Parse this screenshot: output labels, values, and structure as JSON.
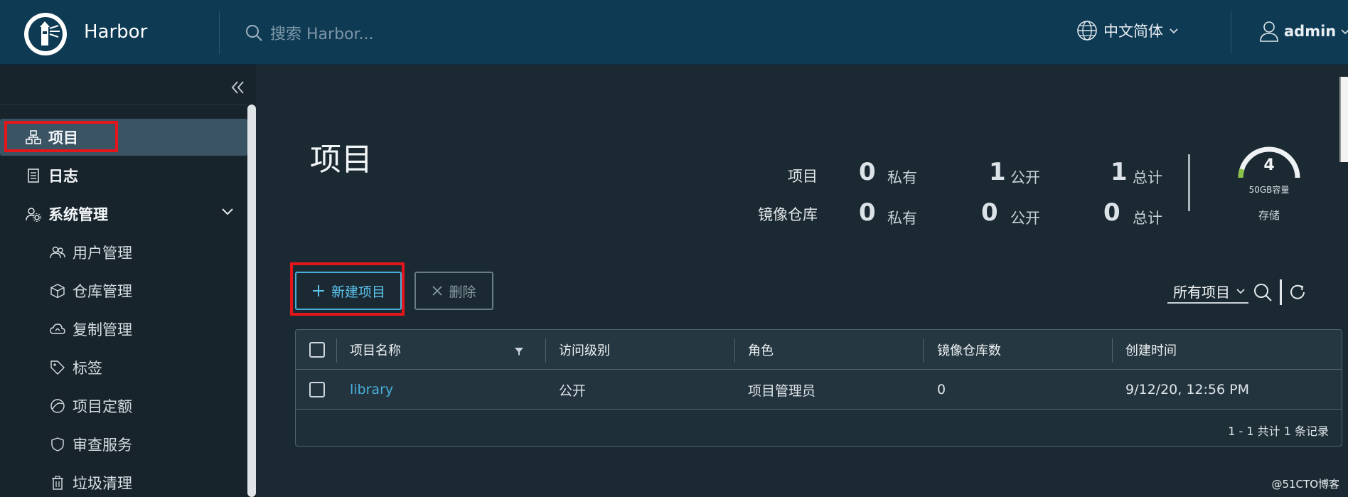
{
  "header": {
    "brand": "Harbor",
    "search_placeholder": "搜索 Harbor...",
    "language": "中文简体",
    "user": "admin"
  },
  "sidebar": {
    "items": [
      {
        "label": "项目",
        "icon": "project-icon",
        "active": true
      },
      {
        "label": "日志",
        "icon": "log-icon"
      },
      {
        "label": "系统管理",
        "icon": "admin-gear-icon"
      },
      {
        "label": "用户管理",
        "icon": "users-icon"
      },
      {
        "label": "仓库管理",
        "icon": "box-icon"
      },
      {
        "label": "复制管理",
        "icon": "cloud-sync-icon"
      },
      {
        "label": "标签",
        "icon": "tag-icon"
      },
      {
        "label": "项目定额",
        "icon": "quota-icon"
      },
      {
        "label": "审查服务",
        "icon": "shield-icon"
      },
      {
        "label": "垃圾清理",
        "icon": "trash-icon"
      }
    ]
  },
  "main": {
    "title": "项目",
    "stats": {
      "row1_label": "项目",
      "row2_label": "镜像仓库",
      "projects": {
        "private": "0",
        "public": "1",
        "total": "1"
      },
      "repos": {
        "private": "0",
        "public": "0",
        "total": "0"
      },
      "unit_private": "私有",
      "unit_public": "公开",
      "unit_total": "总计"
    },
    "storage": {
      "value": "4",
      "capacity": "50GB容量",
      "label": "存储"
    },
    "buttons": {
      "new_project": "新建项目",
      "delete": "删除"
    },
    "filter": {
      "selected": "所有项目"
    },
    "table": {
      "columns": [
        "项目名称",
        "访问级别",
        "角色",
        "镜像仓库数",
        "创建时间"
      ],
      "rows": [
        {
          "name": "library",
          "access": "公开",
          "role": "项目管理员",
          "repo_count": "0",
          "created": "9/12/20, 12:56 PM"
        }
      ],
      "footer": "1 - 1 共计 1 条记录"
    }
  },
  "watermark": "@51CTO博客",
  "colors": {
    "header_bg": "#0e3a54",
    "accent": "#49afd9",
    "highlight_red": "#e5151c"
  }
}
